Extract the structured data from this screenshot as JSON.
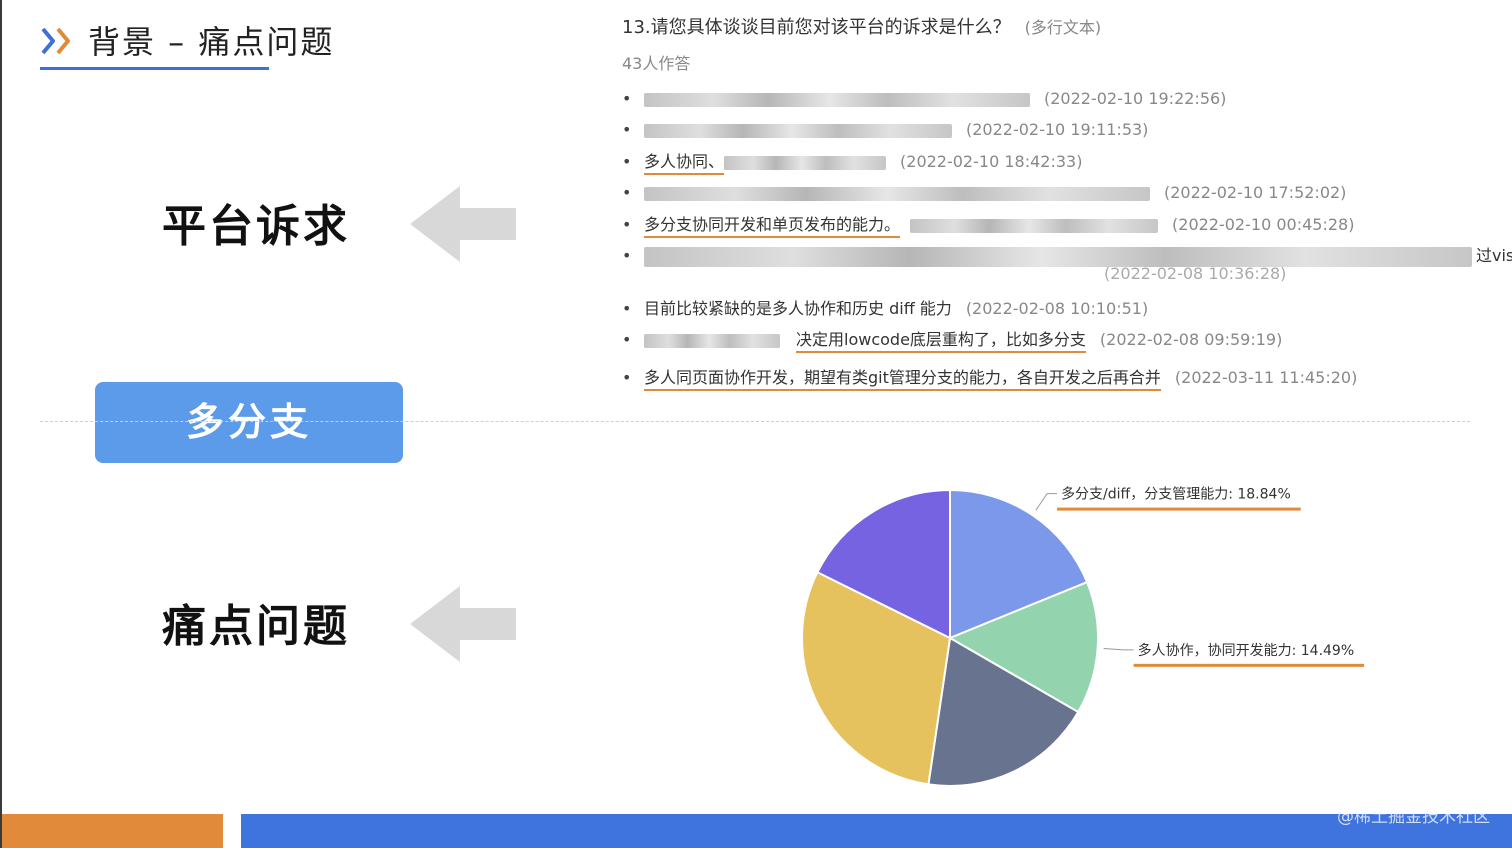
{
  "header": {
    "title": "背景 – 痛点问题"
  },
  "left": {
    "label_top": "平台诉求",
    "pill": "多分支",
    "label_bottom": "痛点问题"
  },
  "survey": {
    "question": "13.请您具体谈谈目前您对该平台的诉求是什么？",
    "question_type": "(多行文本)",
    "answer_count": "43人作答",
    "responses": [
      {
        "text": "",
        "time": "(2022-02-10 19:22:56)"
      },
      {
        "text": "",
        "time": "(2022-02-10 19:11:53)"
      },
      {
        "text": "多人协同、",
        "time": "(2022-02-10 18:42:33)"
      },
      {
        "text": "",
        "time": "(2022-02-10 17:52:02)"
      },
      {
        "text": "多分支协同开发和单页发布的能力。",
        "time": "(2022-02-10 00:45:28)"
      },
      {
        "text": "过visi",
        "time": "(2022-02-08 10:36:28)"
      },
      {
        "text": "目前比较紧缺的是多人协作和历史 diff 能力",
        "time": "(2022-02-08 10:10:51)"
      },
      {
        "text": "决定用lowcode底层重构了，比如多分支",
        "time": "(2022-02-08 09:59:19)"
      },
      {
        "text": "多人同页面协作开发，期望有类git管理分支的能力，各自开发之后再合并",
        "time": "(2022-03-11 11:45:20)"
      }
    ]
  },
  "chart_data": {
    "type": "pie",
    "slices": [
      {
        "label": "多分支/diff，分支管理能力: 18.84%",
        "value": 18.84,
        "color": "#7b98ea"
      },
      {
        "label": "多人协作，协同开发能力: 14.49%",
        "value": 14.49,
        "color": "#93d3ae"
      },
      {
        "label": "",
        "value": 19.0,
        "color": "#68748f"
      },
      {
        "label": "",
        "value": 30.0,
        "color": "#e6c25f"
      },
      {
        "label": "",
        "value": 17.67,
        "color": "#7563e2"
      }
    ]
  },
  "footer": {
    "watermark": "@稀土掘金技术社区"
  }
}
